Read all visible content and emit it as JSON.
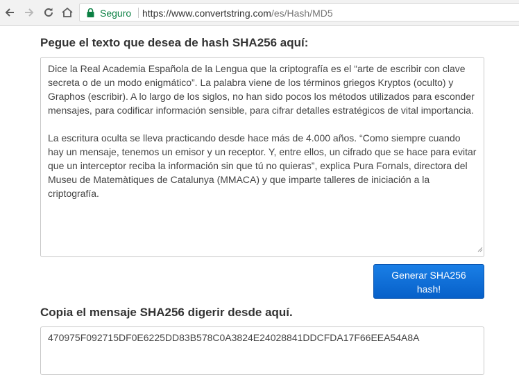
{
  "browser": {
    "secure_label": "Seguro",
    "url_host": "https://www.convertstring.com",
    "url_path": "/es/Hash/MD5"
  },
  "page": {
    "input_heading": "Pegue el texto que desea de hash SHA256 aquí:",
    "input_paragraphs": [
      "Dice la Real Academia Española de la Lengua que la criptografía es el “arte de escribir con clave secreta o de un modo enigmático”. La palabra viene de los términos griegos Kryptos (oculto) y Graphos (escribir). A lo largo de los siglos, no han sido pocos los métodos utilizados para esconder mensajes, para codificar información sensible, para cifrar detalles estratégicos de vital importancia.",
      "La escritura oculta se lleva practicando desde hace más de 4.000 años. “Como siempre cuando hay un mensaje, tenemos un emisor y un receptor. Y, entre ellos, un cifrado que se hace para evitar que un interceptor reciba la información sin que tú no quieras”, explica Pura Fornals, directora del Museu de Matemàtiques de Catalunya (MMACA) y que imparte talleres de iniciación a la criptografía."
    ],
    "generate_button_line1": "Generar SHA256",
    "generate_button_line2": "hash!",
    "output_heading": "Copia el mensaje SHA256 digerir desde aquí.",
    "output_value": "470975F092715DF0E6225DD83B578C0A3824E24028841DDCFDA17F66EEA54A8A"
  },
  "colors": {
    "secure_green": "#0b8043",
    "button_blue": "#0760c9"
  }
}
